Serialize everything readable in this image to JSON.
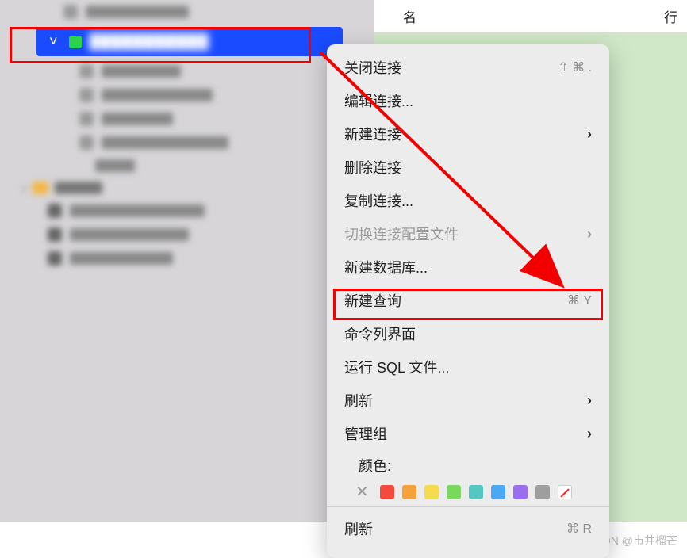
{
  "header": {
    "col_name": "名",
    "col_row": "行"
  },
  "sidebar": {
    "selected_label": "███████████"
  },
  "menu": {
    "close_conn": "关闭连接",
    "close_sc": "⇧ ⌘ .",
    "edit_conn": "编辑连接...",
    "new_conn": "新建连接",
    "delete_conn": "删除连接",
    "dup_conn": "复制连接...",
    "switch_profile": "切换连接配置文件",
    "new_db": "新建数据库...",
    "new_query": "新建查询",
    "new_query_sc": "⌘ Y",
    "cli": "命令列界面",
    "run_sql": "运行 SQL 文件...",
    "refresh": "刷新",
    "manage_group": "管理组",
    "color_label": "颜色:",
    "refresh2": "刷新",
    "refresh2_sc": "⌘ R"
  },
  "colors": [
    "#f24a3d",
    "#f6a13a",
    "#f4dc4e",
    "#7ad85e",
    "#54c7c1",
    "#4aa9f2",
    "#9a6ef0",
    "#9e9e9e"
  ],
  "watermark": "CSDN @市井榴芒"
}
